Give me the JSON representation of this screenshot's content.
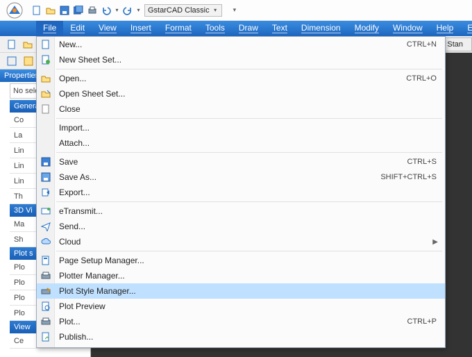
{
  "qat": {
    "workspace": "GstarCAD Classic"
  },
  "menubar": [
    {
      "label": "File",
      "active": true
    },
    {
      "label": "Edit"
    },
    {
      "label": "View"
    },
    {
      "label": "Insert"
    },
    {
      "label": "Format"
    },
    {
      "label": "Tools"
    },
    {
      "label": "Draw"
    },
    {
      "label": "Text"
    },
    {
      "label": "Dimension"
    },
    {
      "label": "Modify"
    },
    {
      "label": "Window"
    },
    {
      "label": "Help"
    },
    {
      "label": "Express"
    }
  ],
  "toolbar2": {
    "rightbtn": "Stan"
  },
  "left": {
    "panel_title": "Properties",
    "no_selection": "No sele",
    "sections": [
      {
        "title": "General",
        "rows": [
          "Co",
          "La",
          "Lin",
          "Lin",
          "Lin",
          "Th"
        ]
      },
      {
        "title": "3D Vi",
        "rows": [
          "Ma",
          "Sh"
        ]
      },
      {
        "title": "Plot s",
        "rows": [
          "Plo",
          "Plo",
          "Plo",
          "Plo"
        ]
      },
      {
        "title": "View",
        "rows": [
          "Ce"
        ]
      }
    ]
  },
  "file_menu": [
    {
      "type": "item",
      "icon": "new-icon",
      "label": "New...",
      "shortcut": "CTRL+N"
    },
    {
      "type": "item",
      "icon": "new-sheet-icon",
      "label": "New Sheet Set..."
    },
    {
      "type": "sep"
    },
    {
      "type": "item",
      "icon": "open-icon",
      "label": "Open...",
      "shortcut": "CTRL+O"
    },
    {
      "type": "item",
      "icon": "open-sheet-icon",
      "label": "Open Sheet Set..."
    },
    {
      "type": "item",
      "icon": "close-icon",
      "label": "Close"
    },
    {
      "type": "sep"
    },
    {
      "type": "item",
      "icon": "import-icon",
      "label": "Import..."
    },
    {
      "type": "item",
      "icon": "attach-icon",
      "label": "Attach..."
    },
    {
      "type": "sep"
    },
    {
      "type": "item",
      "icon": "save-icon",
      "label": "Save",
      "shortcut": "CTRL+S"
    },
    {
      "type": "item",
      "icon": "save-as-icon",
      "label": "Save As...",
      "shortcut": "SHIFT+CTRL+S"
    },
    {
      "type": "item",
      "icon": "export-icon",
      "label": "Export..."
    },
    {
      "type": "sep"
    },
    {
      "type": "item",
      "icon": "etransmit-icon",
      "label": "eTransmit..."
    },
    {
      "type": "item",
      "icon": "send-icon",
      "label": "Send..."
    },
    {
      "type": "item",
      "icon": "cloud-icon",
      "label": "Cloud",
      "submenu": true
    },
    {
      "type": "sep"
    },
    {
      "type": "item",
      "icon": "page-setup-icon",
      "label": "Page Setup Manager..."
    },
    {
      "type": "item",
      "icon": "plotter-mgr-icon",
      "label": "Plotter Manager..."
    },
    {
      "type": "item",
      "icon": "plot-style-icon",
      "label": "Plot Style Manager...",
      "highlight": true
    },
    {
      "type": "item",
      "icon": "plot-preview-icon",
      "label": "Plot Preview"
    },
    {
      "type": "item",
      "icon": "plot-icon",
      "label": "Plot...",
      "shortcut": "CTRL+P"
    },
    {
      "type": "item",
      "icon": "publish-icon",
      "label": "Publish..."
    }
  ]
}
